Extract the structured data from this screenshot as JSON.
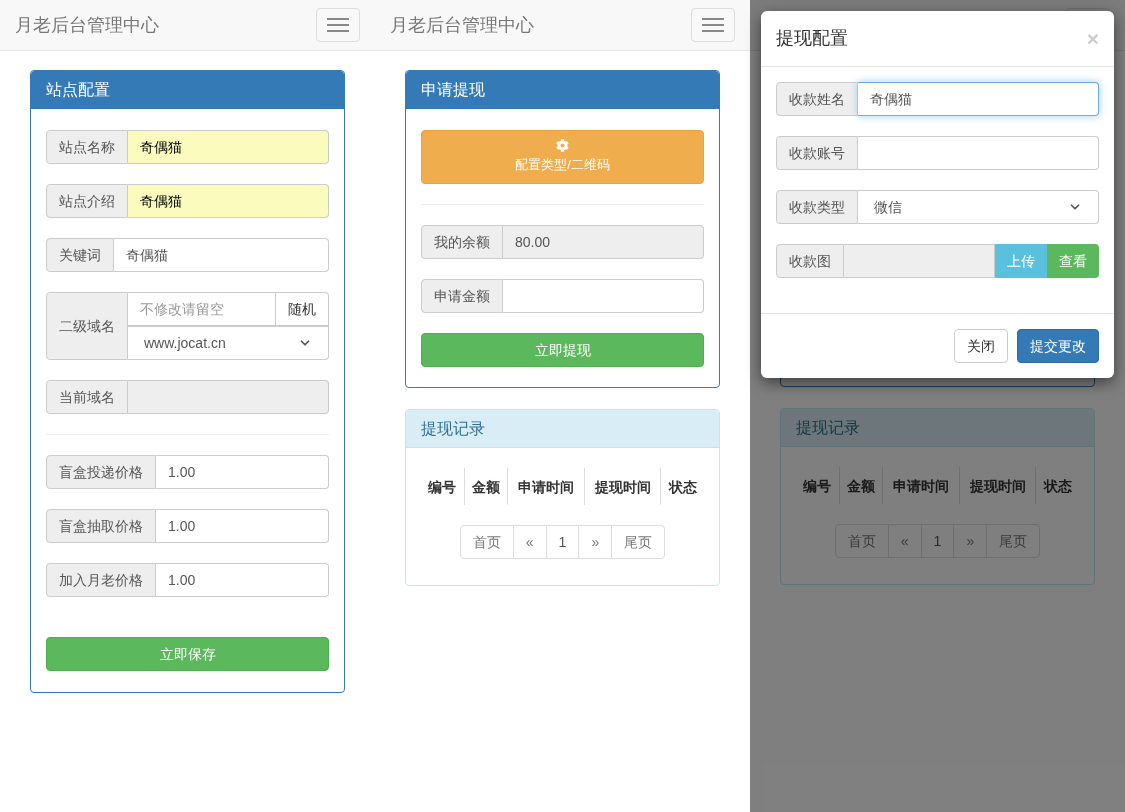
{
  "site_config_screen": {
    "navbar": {
      "title": "月老后台管理中心"
    },
    "panel": {
      "title": "站点配置",
      "fields": [
        {
          "kind": "text",
          "label": "站点名称",
          "value": "奇偶猫",
          "autofilled": true
        },
        {
          "kind": "text",
          "label": "站点介绍",
          "value": "奇偶猫",
          "autofilled": true
        },
        {
          "kind": "text",
          "label": "关键词",
          "value": "奇偶猫",
          "autofilled": false
        },
        {
          "kind": "domain",
          "label": "二级域名",
          "placeholder": "不修改请留空",
          "button": "随机",
          "select_value": "www.jocat.cn"
        },
        {
          "kind": "readonly",
          "label": "当前域名"
        },
        {
          "kind": "divider"
        },
        {
          "kind": "text",
          "label": "盲盒投递价格",
          "value": "1.00",
          "autofilled": false
        },
        {
          "kind": "text",
          "label": "盲盒抽取价格",
          "value": "1.00",
          "autofilled": false
        },
        {
          "kind": "text",
          "label": "加入月老价格",
          "value": "1.00",
          "autofilled": false
        }
      ],
      "save_button": "立即保存"
    }
  },
  "withdraw_screen": {
    "navbar": {
      "title": "月老后台管理中心"
    },
    "withdraw_panel": {
      "title": "申请提现",
      "config_button": "配置类型/二维码",
      "fields": [
        {
          "kind": "readonly",
          "label": "我的余额",
          "value": "80.00"
        },
        {
          "kind": "text",
          "label": "申请金额",
          "autofilled": false
        }
      ],
      "submit_button": "立即提现"
    },
    "records_panel": {
      "title": "提现记录",
      "columns": [
        "编号",
        "金额",
        "申请时间",
        "提现时间",
        "状态"
      ],
      "pagination": [
        "首页",
        "«",
        "1",
        "»",
        "尾页"
      ]
    }
  },
  "modal_screen": {
    "records_panel": {
      "title": "提现记录",
      "columns": [
        "编号",
        "金额",
        "申请时间",
        "提现时间",
        "状态"
      ],
      "pagination": [
        "首页",
        "«",
        "1",
        "»",
        "尾页"
      ]
    },
    "modal": {
      "title": "提现配置",
      "close": "×",
      "fields": [
        {
          "kind": "text",
          "label": "收款姓名",
          "value": "奇偶猫",
          "focused": true
        },
        {
          "kind": "text",
          "label": "收款账号",
          "focused": false
        },
        {
          "kind": "select",
          "label": "收款类型",
          "value": "微信"
        },
        {
          "kind": "upload",
          "label": "收款图",
          "buttons": [
            "上传",
            "查看"
          ]
        }
      ],
      "footer_buttons": [
        {
          "label": "关闭",
          "kind": "default"
        },
        {
          "label": "提交更改",
          "kind": "primary"
        }
      ]
    }
  }
}
